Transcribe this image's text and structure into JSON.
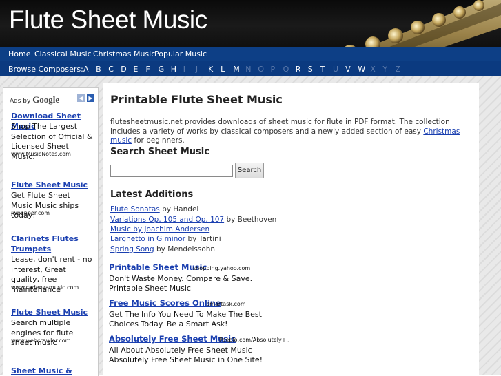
{
  "header": {
    "title": "Flute Sheet Music"
  },
  "nav": {
    "items": [
      "Home",
      "Classical Music",
      "Christmas Music",
      "Popular Music"
    ],
    "browse_label": "Browse Composers:",
    "letters": [
      {
        "l": "A",
        "active": true
      },
      {
        "l": "B",
        "active": true
      },
      {
        "l": "C",
        "active": true
      },
      {
        "l": "D",
        "active": true
      },
      {
        "l": "E",
        "active": true
      },
      {
        "l": "F",
        "active": true
      },
      {
        "l": "G",
        "active": true
      },
      {
        "l": "H",
        "active": true
      },
      {
        "l": "I",
        "active": false
      },
      {
        "l": "J",
        "active": false
      },
      {
        "l": "K",
        "active": true
      },
      {
        "l": "L",
        "active": true
      },
      {
        "l": "M",
        "active": true
      },
      {
        "l": "N",
        "active": false
      },
      {
        "l": "O",
        "active": false
      },
      {
        "l": "P",
        "active": false
      },
      {
        "l": "Q",
        "active": false
      },
      {
        "l": "R",
        "active": true
      },
      {
        "l": "S",
        "active": true
      },
      {
        "l": "T",
        "active": true
      },
      {
        "l": "U",
        "active": false
      },
      {
        "l": "V",
        "active": true
      },
      {
        "l": "W",
        "active": true
      },
      {
        "l": "X",
        "active": false
      },
      {
        "l": "Y",
        "active": false
      },
      {
        "l": "Z",
        "active": false
      }
    ]
  },
  "sidebar": {
    "ads_by": "Ads by",
    "google": "Google",
    "ads": [
      {
        "title": "Download Sheet Music",
        "text": "Shop The Largest Selection of Official & Licensed Sheet Music.",
        "url": "www.MusicNotes.com"
      },
      {
        "title": "Flute Sheet Music",
        "text": "Get Flute Sheet Music Music ships today!",
        "url": "jwpepper.com"
      },
      {
        "title": "Clarinets Flutes Trumpets",
        "text": "Lease, don't rent - no interest, Great quality, free maintenance",
        "url": "www.cadenzamusic.com"
      },
      {
        "title": "Flute Sheet Music",
        "text": "Search multiple engines for flute sheet music",
        "url": "www.webcrawler.com"
      },
      {
        "title": "Sheet Music &",
        "text": "",
        "url": ""
      }
    ]
  },
  "main": {
    "title": "Printable Flute Sheet Music",
    "intro_before": "flutesheetmusic.net provides downloads of sheet music for flute in PDF format. The collection includes a variety of works by classical composers and a newly added section of easy ",
    "intro_link": "Christmas music",
    "intro_after": " for beginners.",
    "search_heading": "Search Sheet Music",
    "search_value": "",
    "search_button": "Search",
    "latest_heading": "Latest Additions",
    "latest": [
      {
        "link": "Flute Sonatas",
        "by": " by Handel"
      },
      {
        "link": "Variations Op. 105 and Op. 107",
        "by": " by Beethoven"
      },
      {
        "link": "Music by Joachim Andersen",
        "by": ""
      },
      {
        "link": "Larghetto in G minor",
        "by": " by Tartini"
      },
      {
        "link": "Spring Song",
        "by": " by Mendelssohn"
      }
    ],
    "ads": [
      {
        "title": "Printable Sheet Music",
        "url": "shopping.yahoo.com",
        "text": "Don't Waste Money. Compare & Save. Printable Sheet Music"
      },
      {
        "title": "Free Music Scores Online",
        "url": "smartask.com",
        "text": "Get The Info You Need To Make The Best Choices Today. Be a Smart Ask!"
      },
      {
        "title": "Absolutely Free Sheet Music",
        "url": "Peeplo.com/Absolutely+..",
        "text": "All About Absolutely Free Sheet Music Absolutely Free Sheet Music in One Site!"
      }
    ]
  }
}
